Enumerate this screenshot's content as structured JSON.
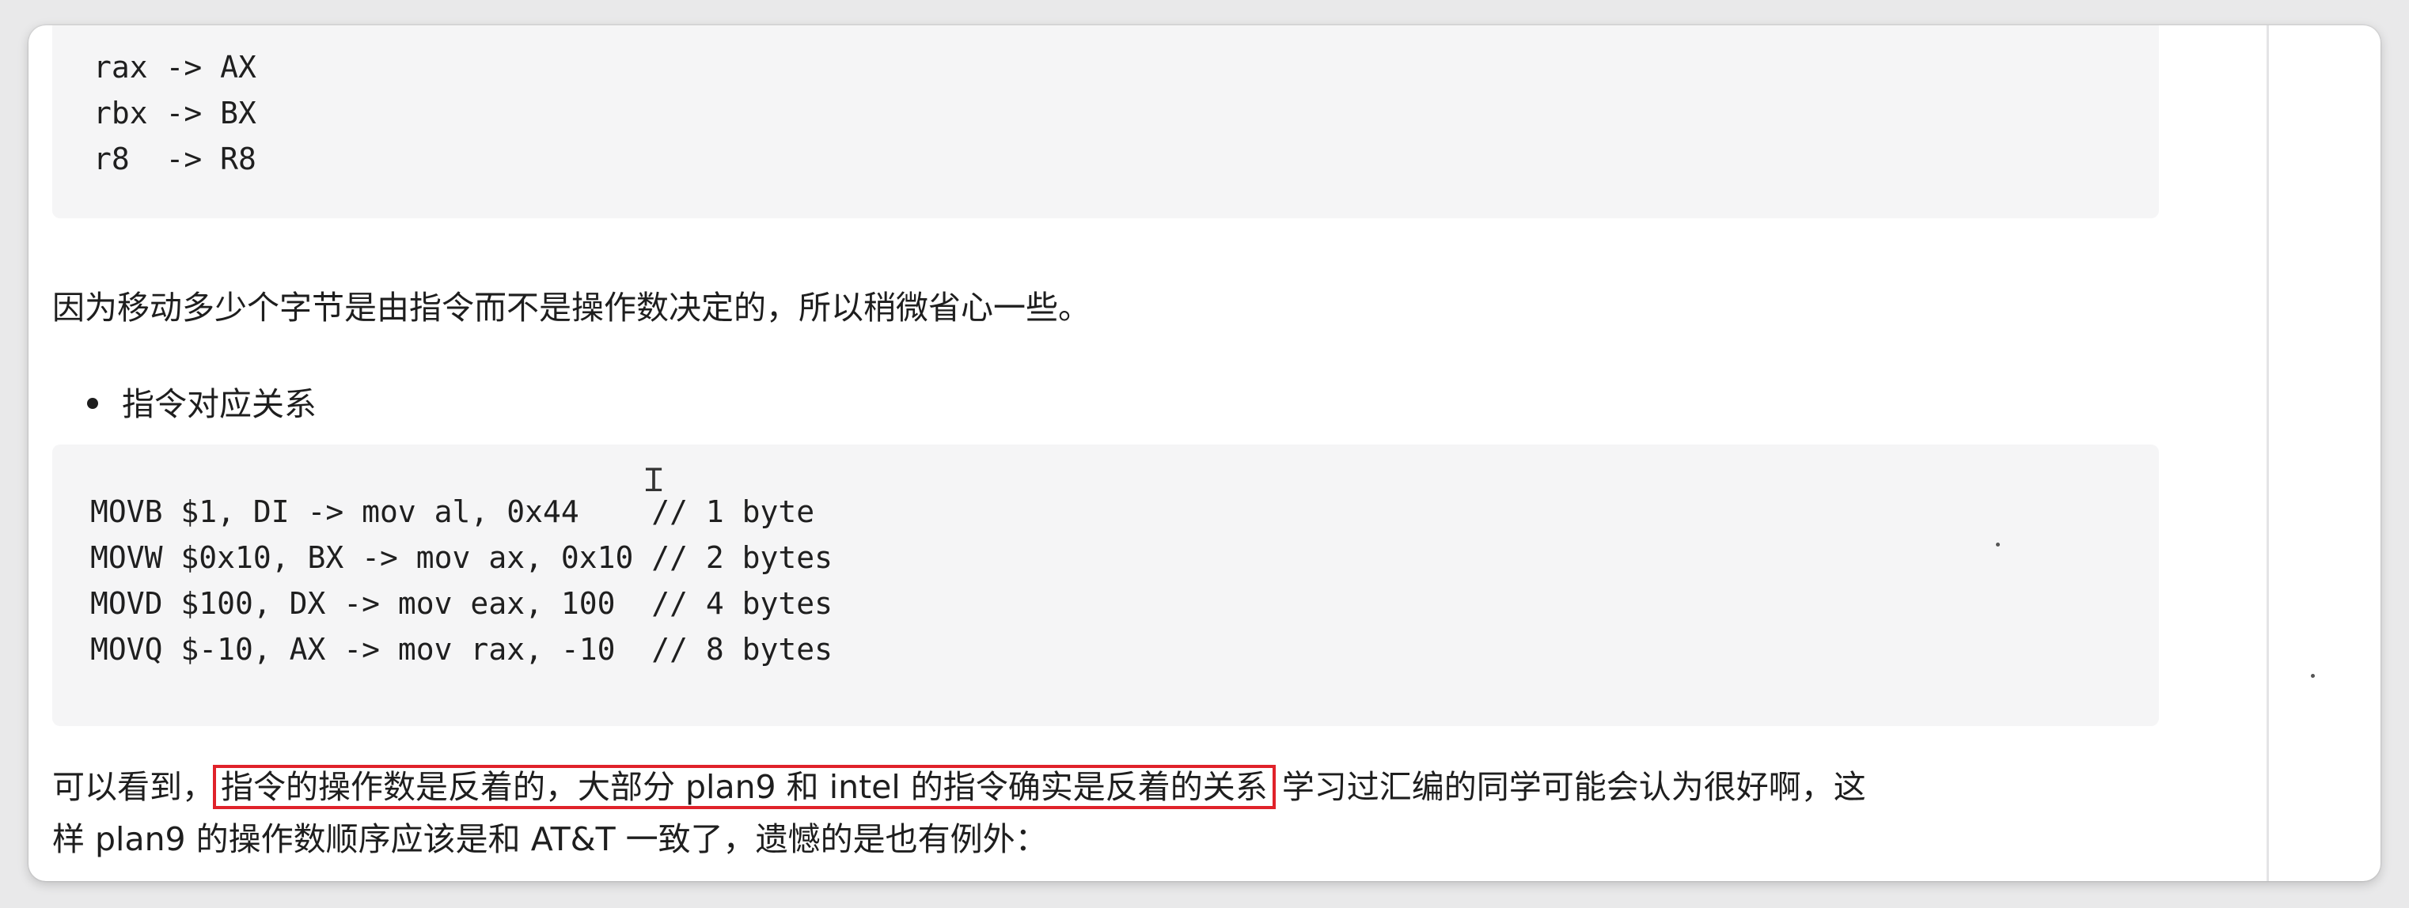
{
  "code_block_1": {
    "lines": [
      "rax -> AX",
      "rbx -> BX",
      "r8  -> R8"
    ]
  },
  "paragraph_1": "因为移动多少个字节是由指令而不是操作数决定的，所以稍微省心一些。",
  "bullet_1": "指令对应关系",
  "code_block_2": {
    "lines": [
      "MOVB $1, DI -> mov al, 0x44    // 1 byte",
      "MOVW $0x10, BX -> mov ax, 0x10 // 2 bytes",
      "MOVD $100, DX -> mov eax, 100  // 4 bytes",
      "MOVQ $-10, AX -> mov rax, -10  // 8 bytes"
    ]
  },
  "paragraph_2": {
    "prefix": "可以看到，",
    "highlighted": "指令的操作数是反着的，大部分 plan9 和 intel 的指令确实是反着的关系",
    "suffix": "学习过汇编的同学可能会认为很好啊，这",
    "line2": "样 plan9 的操作数顺序应该是和 AT&T 一致了，遗憾的是也有例外："
  },
  "colors": {
    "highlight_border": "#e0222a",
    "code_bg": "#f5f5f6"
  }
}
